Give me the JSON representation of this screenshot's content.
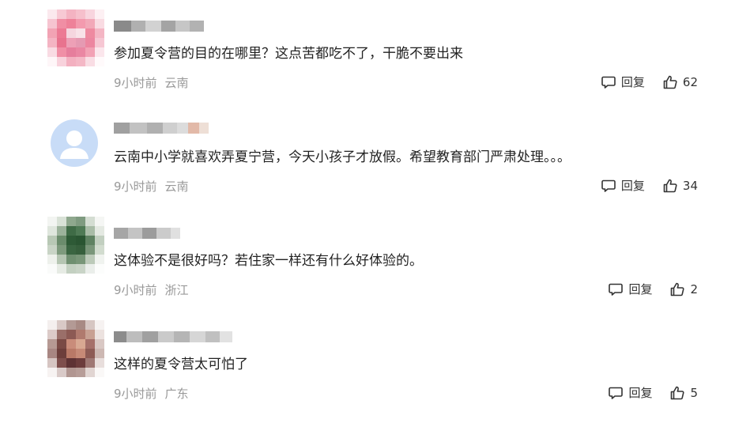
{
  "comments": [
    {
      "text": "参加夏令营的目的在哪里？这点苦都吃不了，干脆不要出来",
      "time": "9小时前",
      "location": "云南",
      "reply_label": "回复",
      "likes": "62"
    },
    {
      "text": "云南中小学就喜欢弄夏宁营，今天小孩子才放假。希望教育部门严肃处理。。。",
      "time": "9小时前",
      "location": "云南",
      "reply_label": "回复",
      "likes": "34"
    },
    {
      "text": "这体验不是很好吗？若住家一样还有什么好体验的。",
      "time": "9小时前",
      "location": "浙江",
      "reply_label": "回复",
      "likes": "2"
    },
    {
      "text": "这样的夏令营太可怕了",
      "time": "9小时前",
      "location": "广东",
      "reply_label": "回复",
      "likes": "5"
    }
  ],
  "icons": {
    "reply": "comment-bubble-icon",
    "like": "thumbs-up-icon",
    "default_avatar": "user-silhouette-icon"
  },
  "colors": {
    "comment_text": "#222222",
    "meta_text": "#999999",
    "action_text": "#333333",
    "default_avatar_bg": "#c8dcf7"
  }
}
